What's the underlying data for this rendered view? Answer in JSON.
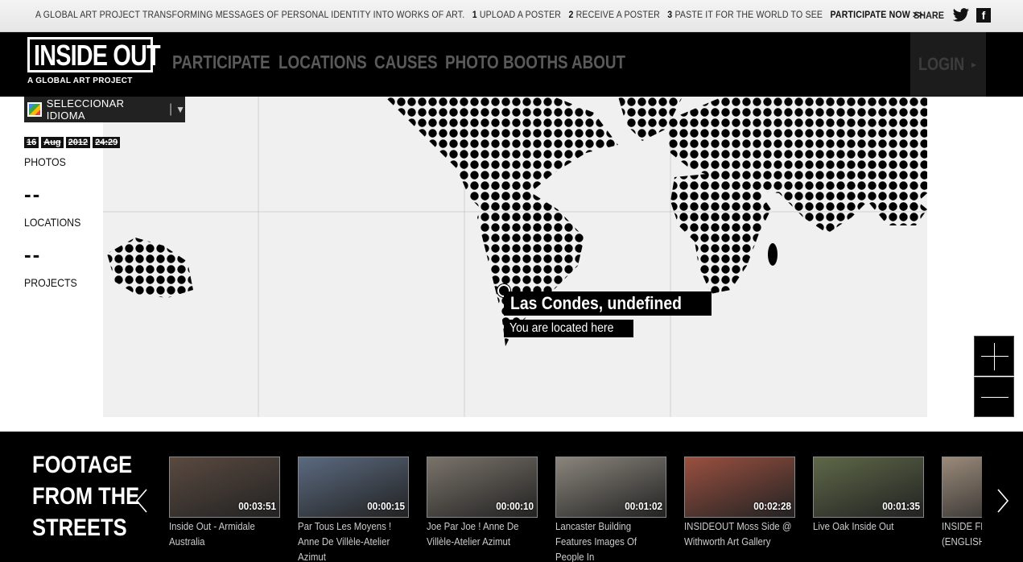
{
  "topbar": {
    "tagline": "A GLOBAL ART PROJECT TRANSFORMING MESSAGES OF PERSONAL IDENTITY INTO WORKS OF ART.",
    "step1_num": "1",
    "step1": "UPLOAD A POSTER",
    "step2_num": "2",
    "step2": "RECEIVE A POSTER",
    "step3_num": "3",
    "step3": "PASTE IT FOR THE WORLD TO SEE",
    "participate": "PARTICIPATE NOW >>",
    "share": "SHARE",
    "twitter_icon": "twitter-icon",
    "facebook_icon": "facebook-icon",
    "facebook_glyph": "f"
  },
  "header": {
    "logo": "INSIDE OUT",
    "logo_sub": "A GLOBAL ART PROJECT",
    "nav": [
      "PARTICIPATE",
      "LOCATIONS",
      "CAUSES",
      "PHOTO BOOTHS",
      "ABOUT"
    ],
    "login": "LOGIN",
    "login_arrow": "▸"
  },
  "language": {
    "label": "SELECCIONAR IDIOMA",
    "separator": "|",
    "caret": "▼"
  },
  "stats": {
    "date": [
      "16",
      "Aug",
      "2012",
      "24:29"
    ],
    "photos_label": "PHOTOS",
    "locations_value": "--",
    "locations_label": "LOCATIONS",
    "projects_value": "--",
    "projects_label": "PROJECTS"
  },
  "location": {
    "title": "Las Condes, undefined",
    "subtitle": "You are located here"
  },
  "footage": {
    "title_line1": "FOOTAGE",
    "title_line2": "FROM THE",
    "title_line3": "STREETS",
    "videos": [
      {
        "duration": "00:03:51",
        "caption": "Inside Out - Armidale Australia",
        "tint": "#5a4a40"
      },
      {
        "duration": "00:00:15",
        "caption": "Par Tous Les Moyens ! Anne De Villèle-Atelier Azimut",
        "tint": "#5b6a80"
      },
      {
        "duration": "00:00:10",
        "caption": "Joe Par Joe ! Anne De Villèle-Atelier Azimut",
        "tint": "#7a736a"
      },
      {
        "duration": "00:01:02",
        "caption": "Lancaster Building Features Images Of People In",
        "tint": "#8a857c"
      },
      {
        "duration": "00:02:28",
        "caption": "INSIDEOUT Moss Side @ Withworth Art Gallery",
        "tint": "#9a5040"
      },
      {
        "duration": "00:01:35",
        "caption": "Live Oak Inside Out",
        "tint": "#5e6848"
      },
      {
        "duration": "",
        "caption": "INSIDE FR PROJECT (ENGLISH",
        "tint": "#9a8a7a"
      }
    ]
  }
}
